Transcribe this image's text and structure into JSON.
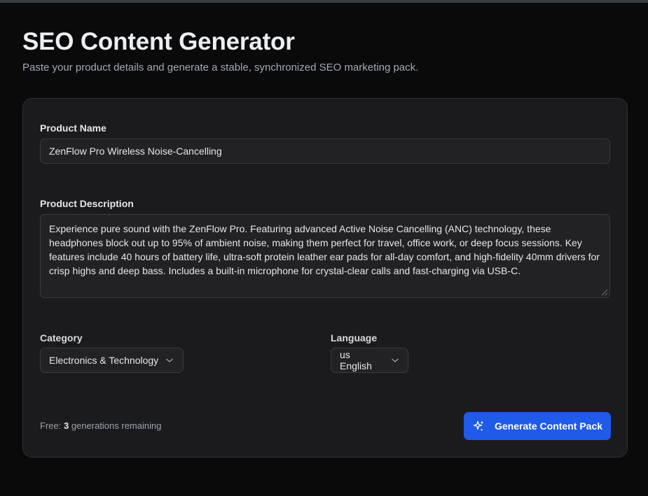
{
  "header": {
    "title": "SEO Content Generator",
    "subtitle": "Paste your product details and generate a stable, synchronized SEO marketing pack."
  },
  "form": {
    "product_name": {
      "label": "Product Name",
      "value": "ZenFlow Pro Wireless Noise-Cancelling"
    },
    "product_description": {
      "label": "Product Description",
      "value": "Experience pure sound with the ZenFlow Pro. Featuring advanced Active Noise Cancelling (ANC) technology, these headphones block out up to 95% of ambient noise, making them perfect for travel, office work, or deep focus sessions. Key features include 40 hours of battery life, ultra-soft protein leather ear pads for all-day comfort, and high-fidelity 40mm drivers for crisp highs and deep bass. Includes a built-in microphone for crystal-clear calls and fast-charging via USB-C."
    },
    "category": {
      "label": "Category",
      "selected": "Electronics & Technology"
    },
    "language": {
      "label": "Language",
      "selected": "us English"
    }
  },
  "footer": {
    "quota_prefix": "Free: ",
    "quota_count": "3",
    "quota_suffix": " generations remaining",
    "generate_label": "Generate Content Pack"
  },
  "colors": {
    "accent": "#1f5ae8",
    "background": "#0a0a0b",
    "card": "#1b1b1d"
  },
  "icons": {
    "generate": "sparkles-icon",
    "dropdown": "chevron-down-icon"
  }
}
